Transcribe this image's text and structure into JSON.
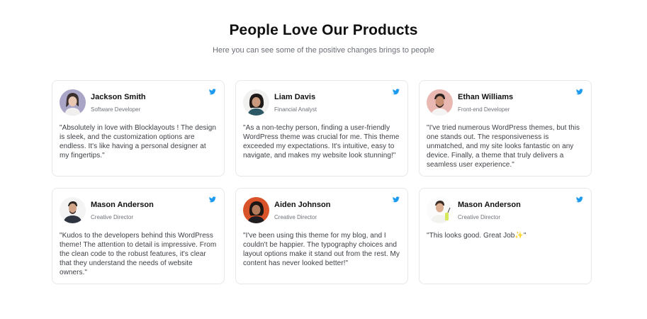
{
  "section": {
    "title": "People Love Our Products",
    "subtitle": "Here you can see some of the positive changes brings to people"
  },
  "testimonials": [
    {
      "name": "Jackson Smith",
      "role": "Software Developer",
      "quote": "\"Absolutely in love with Blocklayouts ! The design is sleek, and the customization options are endless. It's like having a personal designer at my fingertips.\"",
      "social_icon": "twitter-icon"
    },
    {
      "name": "Liam Davis",
      "role": "Financial Analyst",
      "quote": "\"As a non-techy person, finding a user-friendly WordPress theme was crucial for me. This theme exceeded my expectations. It's intuitive, easy to navigate, and makes my website look stunning!\"",
      "social_icon": "twitter-icon"
    },
    {
      "name": "Ethan Williams",
      "role": "Front-end Developer",
      "quote": "\"I've tried numerous WordPress themes, but this one stands out. The responsiveness is unmatched, and my site looks fantastic on any device. Finally, a theme that truly delivers a seamless user experience.\"",
      "social_icon": "twitter-icon"
    },
    {
      "name": "Mason Anderson",
      "role": "Creative Director",
      "quote": "\"Kudos to the developers behind this WordPress theme! The attention to detail is impressive. From the clean code to the robust features, it's clear that they understand the needs of website owners.\"",
      "social_icon": "twitter-icon"
    },
    {
      "name": "Aiden Johnson",
      "role": "Creative Director",
      "quote": "\"I've been using this theme for my blog, and I couldn't be happier. The typography choices and layout options make it stand out from the rest. My content has never looked better!\"",
      "social_icon": "twitter-icon"
    },
    {
      "name": "Mason Anderson",
      "role": "Creative Director",
      "quote": "\"This looks good. Great Job✨\"",
      "social_icon": "twitter-icon"
    }
  ],
  "colors": {
    "twitter": "#1d9bf0",
    "card_border": "#e6e7ea",
    "heading": "#111111",
    "muted": "#6b6f76"
  }
}
